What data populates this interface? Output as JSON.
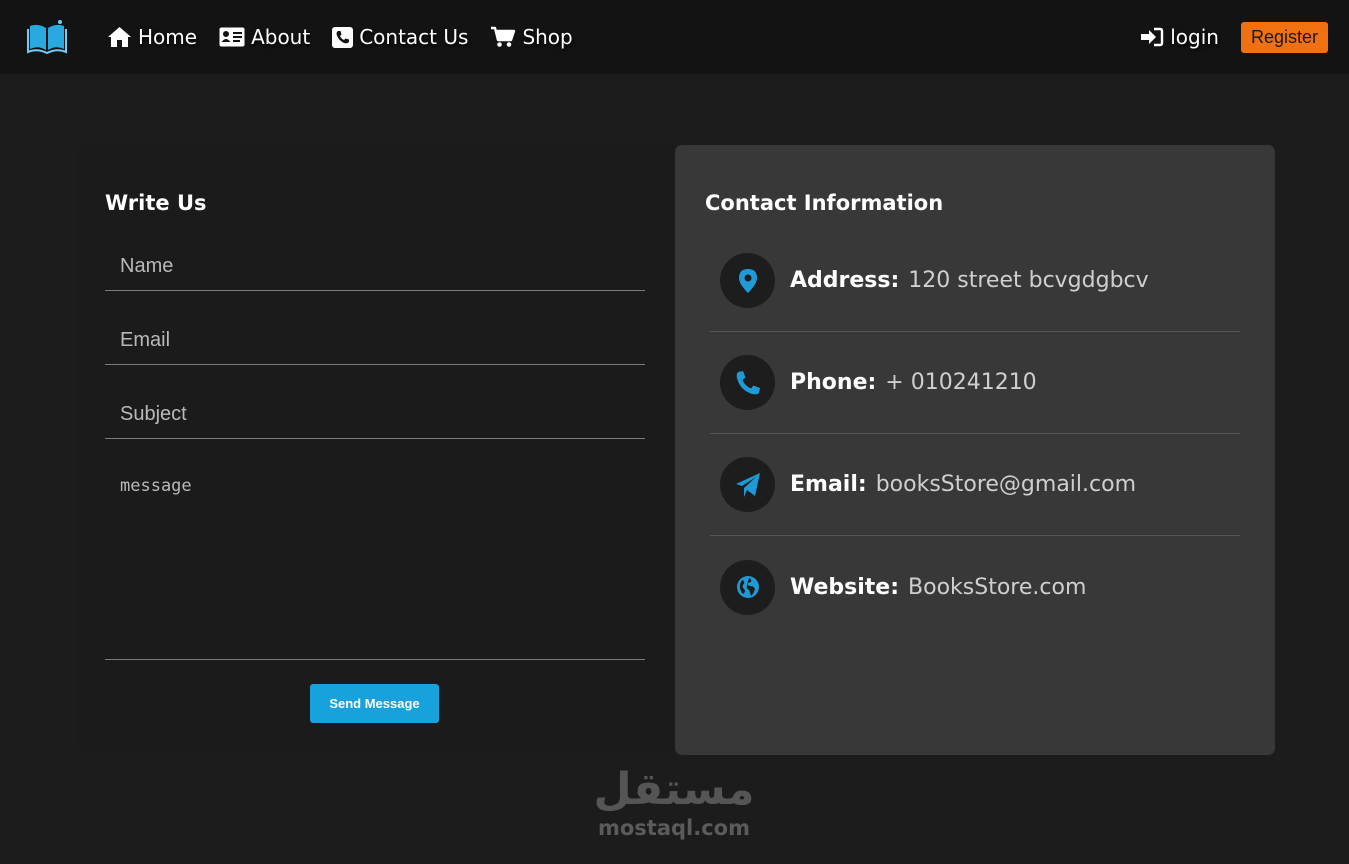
{
  "nav": {
    "logo_icon": "book-icon",
    "links": [
      {
        "label": "Home",
        "icon": "home-icon"
      },
      {
        "label": "About",
        "icon": "id-card-icon"
      },
      {
        "label": "Contact Us",
        "icon": "phone-square-icon"
      },
      {
        "label": "Shop",
        "icon": "cart-icon"
      }
    ],
    "login_label": "login",
    "register_label": "Register"
  },
  "form": {
    "title": "Write Us",
    "name_placeholder": "Name",
    "email_placeholder": "Email",
    "subject_placeholder": "Subject",
    "message_placeholder": "message",
    "send_label": "Send Message"
  },
  "contact": {
    "title": "Contact Information",
    "items": [
      {
        "label": "Address:",
        "value": "120 street bcvgdgbcv",
        "icon": "location-pin-icon"
      },
      {
        "label": "Phone:",
        "value": "+ 010241210",
        "icon": "phone-icon"
      },
      {
        "label": "Email:",
        "value": "booksStore@gmail.com",
        "icon": "paper-plane-icon"
      },
      {
        "label": "Website:",
        "value": "BooksStore.com",
        "icon": "globe-icon"
      }
    ]
  },
  "watermark": {
    "arabic": "مستقل",
    "latin": "mostaql.com"
  },
  "colors": {
    "background": "#1c1c1c",
    "navbar": "#131313",
    "accent_blue": "#17a2dc",
    "register_orange": "#f07112",
    "info_card": "#383838"
  }
}
